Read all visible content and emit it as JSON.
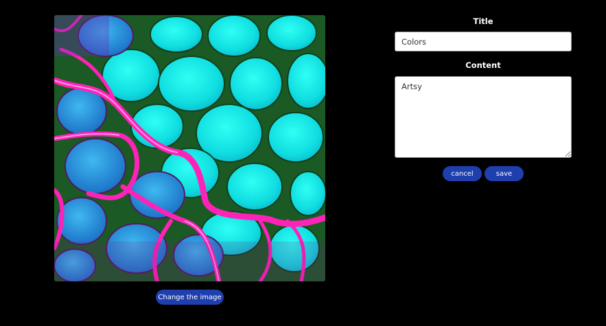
{
  "image": {
    "description_icon": "abstract-image"
  },
  "change_image_button": {
    "label": "Change the image"
  },
  "form": {
    "title_label": "Title",
    "title_value": "Colors",
    "content_label": "Content",
    "content_value": "Artsy",
    "cancel_label": "cancel",
    "save_label": "save"
  },
  "colors": {
    "background": "#000000",
    "button": "#1f3fae",
    "image_cyan": "#12e4e6",
    "image_magenta": "#ff1fae",
    "image_green": "#1d6b1d",
    "image_blue": "#1a8fe0"
  }
}
